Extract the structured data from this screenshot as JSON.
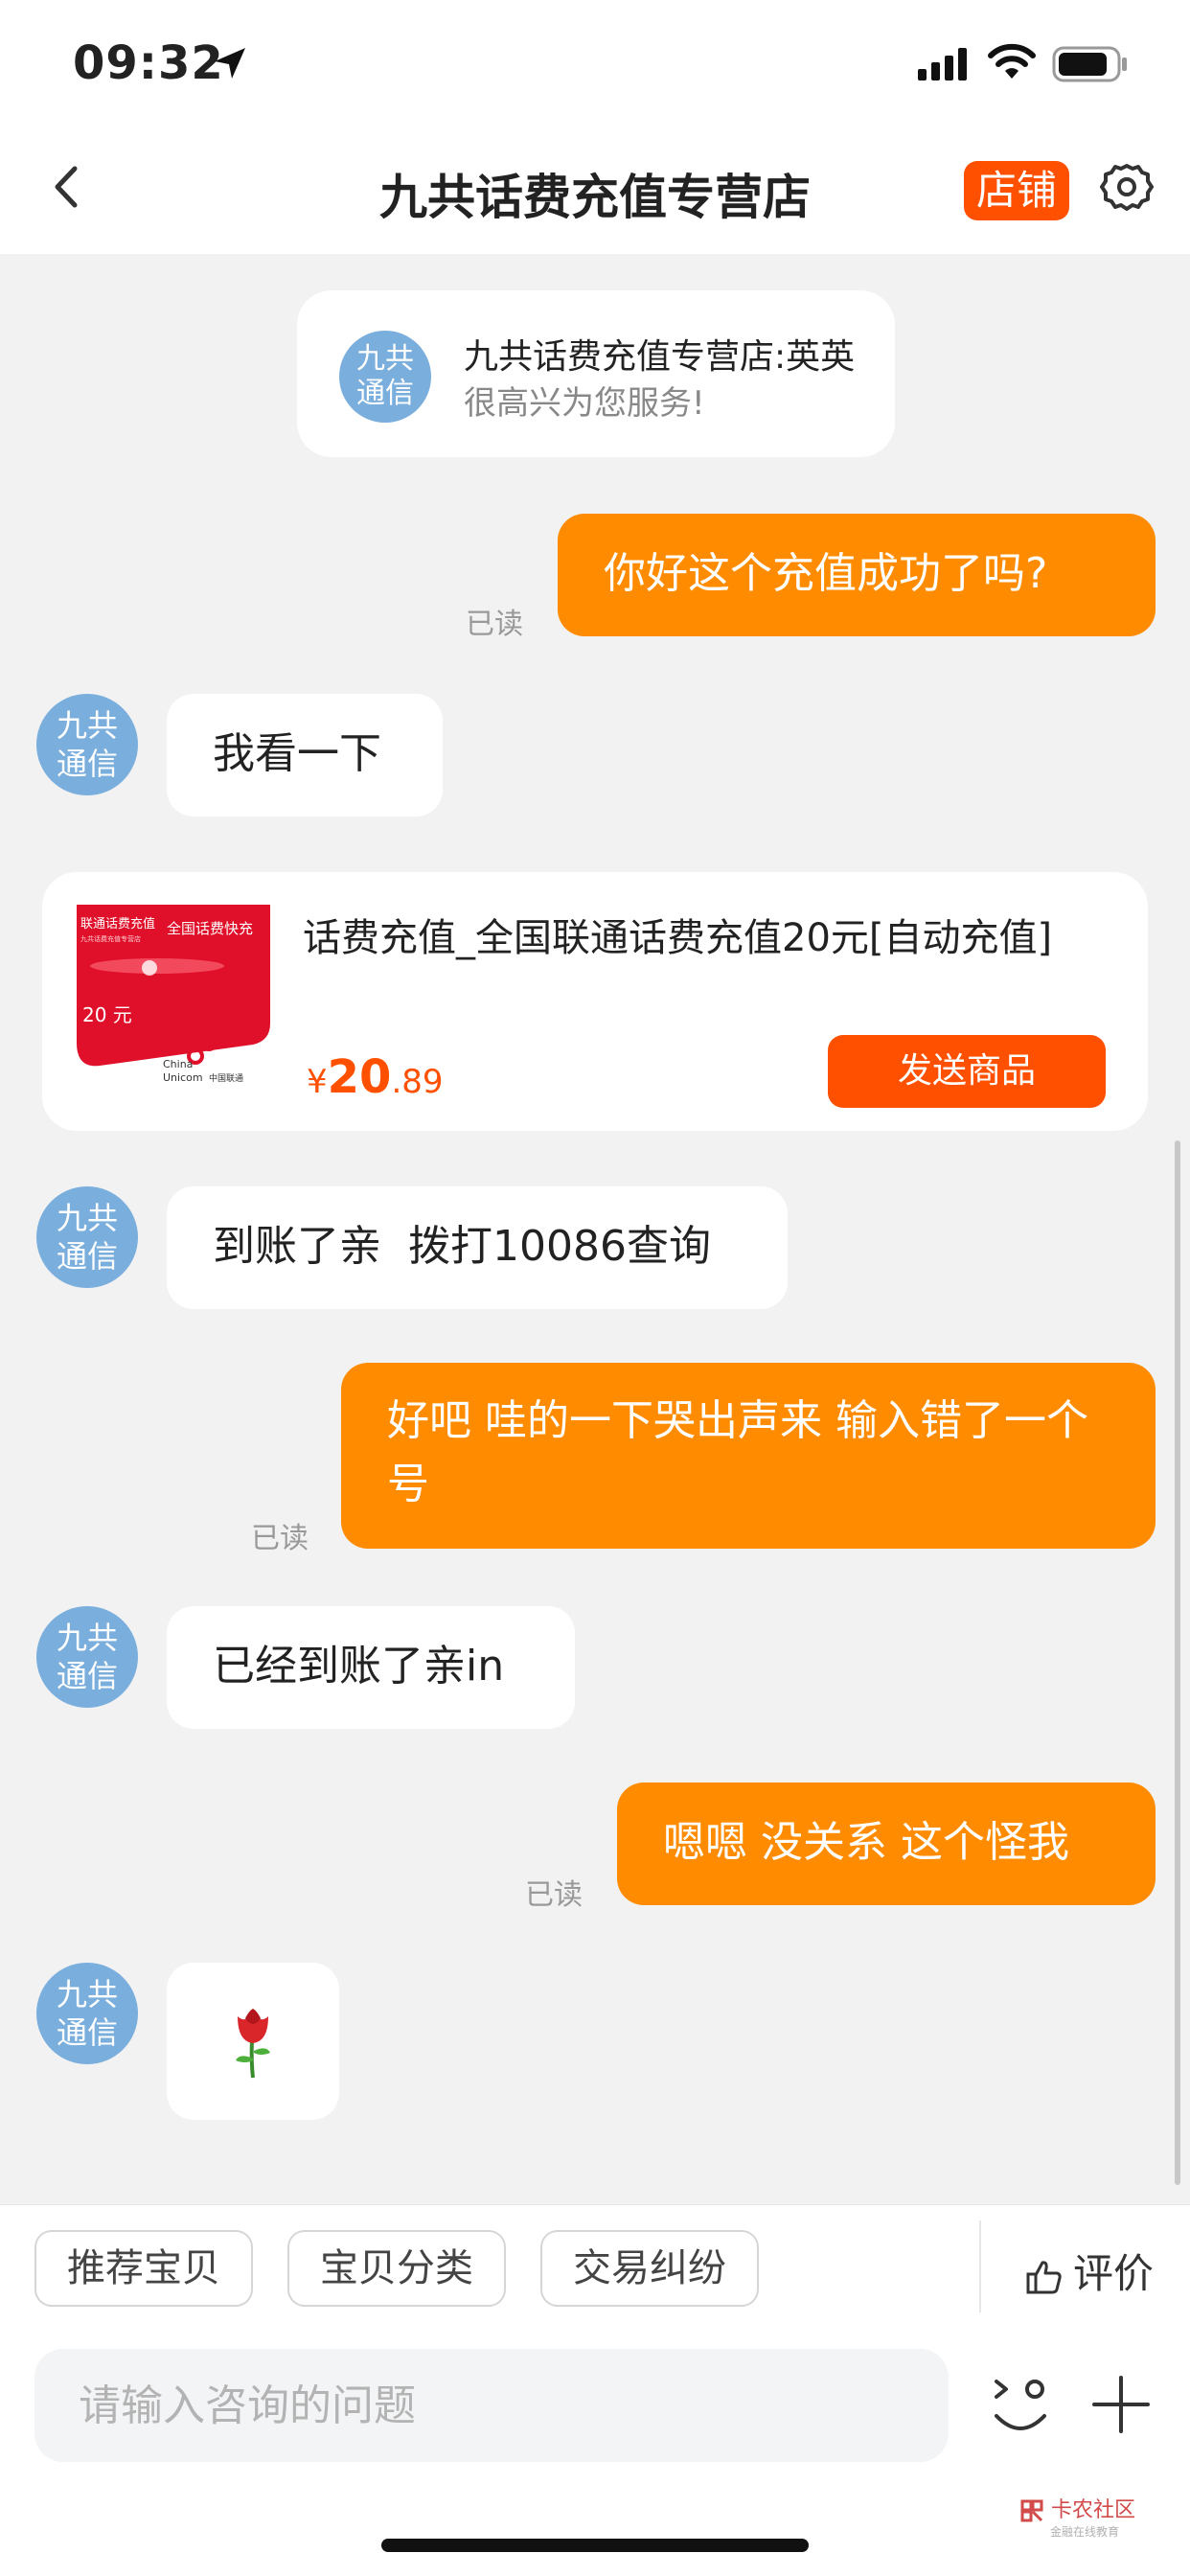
{
  "status_bar": {
    "time": "09:32"
  },
  "nav": {
    "title": "九共话费充值专营店",
    "shop_label": "店铺"
  },
  "welcome": {
    "avatar_text": "九共\n通信",
    "name": "九共话费充值专营店:英英",
    "text": "很高兴为您服务!"
  },
  "avatar_text": "九共\n通信",
  "messages": [
    {
      "from": "me",
      "text": "你好这个充值成功了吗?",
      "read": "已读"
    },
    {
      "from": "them",
      "text": "我看一下"
    },
    {
      "from": "them",
      "text": "到账了亲  拨打10086查询"
    },
    {
      "from": "me",
      "text": "好吧 哇的一下哭出声来 输入错了一个号",
      "read": "已读"
    },
    {
      "from": "them",
      "text": "已经到账了亲in"
    },
    {
      "from": "me",
      "text": "嗯嗯 没关系 这个怪我",
      "read": "已读"
    },
    {
      "from": "them",
      "text": "🌹"
    }
  ],
  "product": {
    "title": "话费充值_全国联通话费充值20元[自动充值]",
    "price_symbol": "¥",
    "price_int": "20",
    "price_dec": ".89",
    "send_label": "发送商品",
    "card": {
      "top_left": "联通话费充值",
      "top_left_sub": "九共话费充值专营店",
      "top_right": "全国话费快充",
      "amount": "20 元",
      "brand_en_1": "China",
      "brand_en_2": "Unicom",
      "brand_cn": "中国联通"
    }
  },
  "quick_actions": [
    "推荐宝贝",
    "宝贝分类",
    "交易纠纷"
  ],
  "rate_label": "评价",
  "input": {
    "placeholder": "请输入咨询的问题"
  },
  "watermark": {
    "text": "卡农社区",
    "sub": "金融在线教育"
  },
  "colors": {
    "accent": "#ff5000",
    "my_bubble": "#ff8c00",
    "avatar": "#7aaedd"
  }
}
